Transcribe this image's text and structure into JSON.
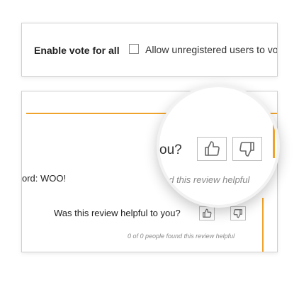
{
  "settings": {
    "enable_vote_label": "Enable vote for all",
    "allow_unregistered_label": "Allow unregistered users to vot",
    "allow_unregistered_checked": false
  },
  "review": {
    "review_text_fragment": "ord: WOO!",
    "helpful_question": "Was this review helpful to you?",
    "helpful_count_text": "0 of 0 people found this review helpful",
    "upvote_icon": "thumbs-up-icon",
    "downvote_icon": "thumbs-down-icon"
  },
  "magnifier": {
    "question_fragment": "ou?",
    "count_fragment": "nd this review helpful"
  },
  "colors": {
    "accent_orange": "#f0a32a",
    "border_gray": "#cfcfcf",
    "muted_text": "#8a8a8a"
  }
}
